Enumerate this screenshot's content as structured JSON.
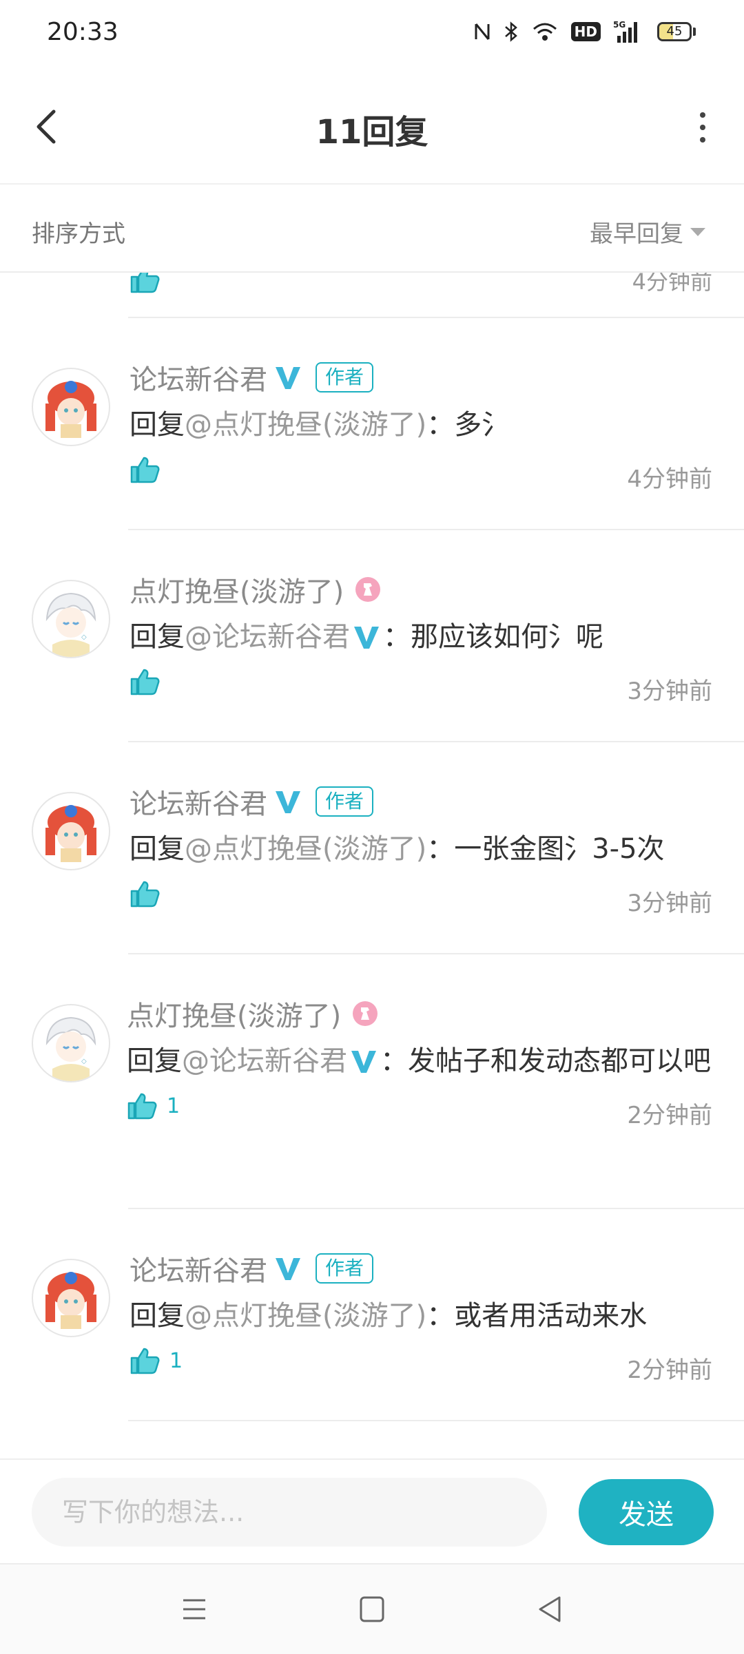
{
  "status_bar": {
    "time": "20:33",
    "battery": "45",
    "battery_fraction": 0.45,
    "network": "5G",
    "hd": "HD"
  },
  "header": {
    "title": "11回复"
  },
  "sort": {
    "label": "排序方式",
    "value": "最早回复"
  },
  "partial_item": {
    "time": "4分钟前"
  },
  "comments": [
    {
      "user": "论坛新谷君",
      "verified": true,
      "author_tag": "作者",
      "prefix": "回复",
      "mention": "@点灯挽昼(淡游了)",
      "text": "：多氵",
      "likes": "",
      "time": "4分钟前"
    },
    {
      "user": "点灯挽昼(淡游了)",
      "verified": false,
      "prefix": "回复",
      "mention": "@论坛新谷君",
      "mention_verified": true,
      "text": "：那应该如何氵呢",
      "likes": "",
      "time": "3分钟前"
    },
    {
      "user": "论坛新谷君",
      "verified": true,
      "author_tag": "作者",
      "prefix": "回复",
      "mention": "@点灯挽昼(淡游了)",
      "text": "：一张金图氵3-5次",
      "likes": "",
      "time": "3分钟前"
    },
    {
      "user": "点灯挽昼(淡游了)",
      "verified": false,
      "prefix": "回复",
      "mention": "@论坛新谷君",
      "mention_verified": true,
      "text": "：发帖子和发动态都可以吧",
      "likes": "1",
      "time": "2分钟前"
    },
    {
      "user": "论坛新谷君",
      "verified": true,
      "author_tag": "作者",
      "prefix": "回复",
      "mention": "@点灯挽昼(淡游了)",
      "text": "：或者用活动来水",
      "likes": "1",
      "time": "2分钟前"
    }
  ],
  "composer": {
    "placeholder": "写下你的想法...",
    "send_label": "发送"
  },
  "colors": {
    "accent": "#1fb2c2",
    "text": "#333333",
    "muted": "#999999"
  }
}
